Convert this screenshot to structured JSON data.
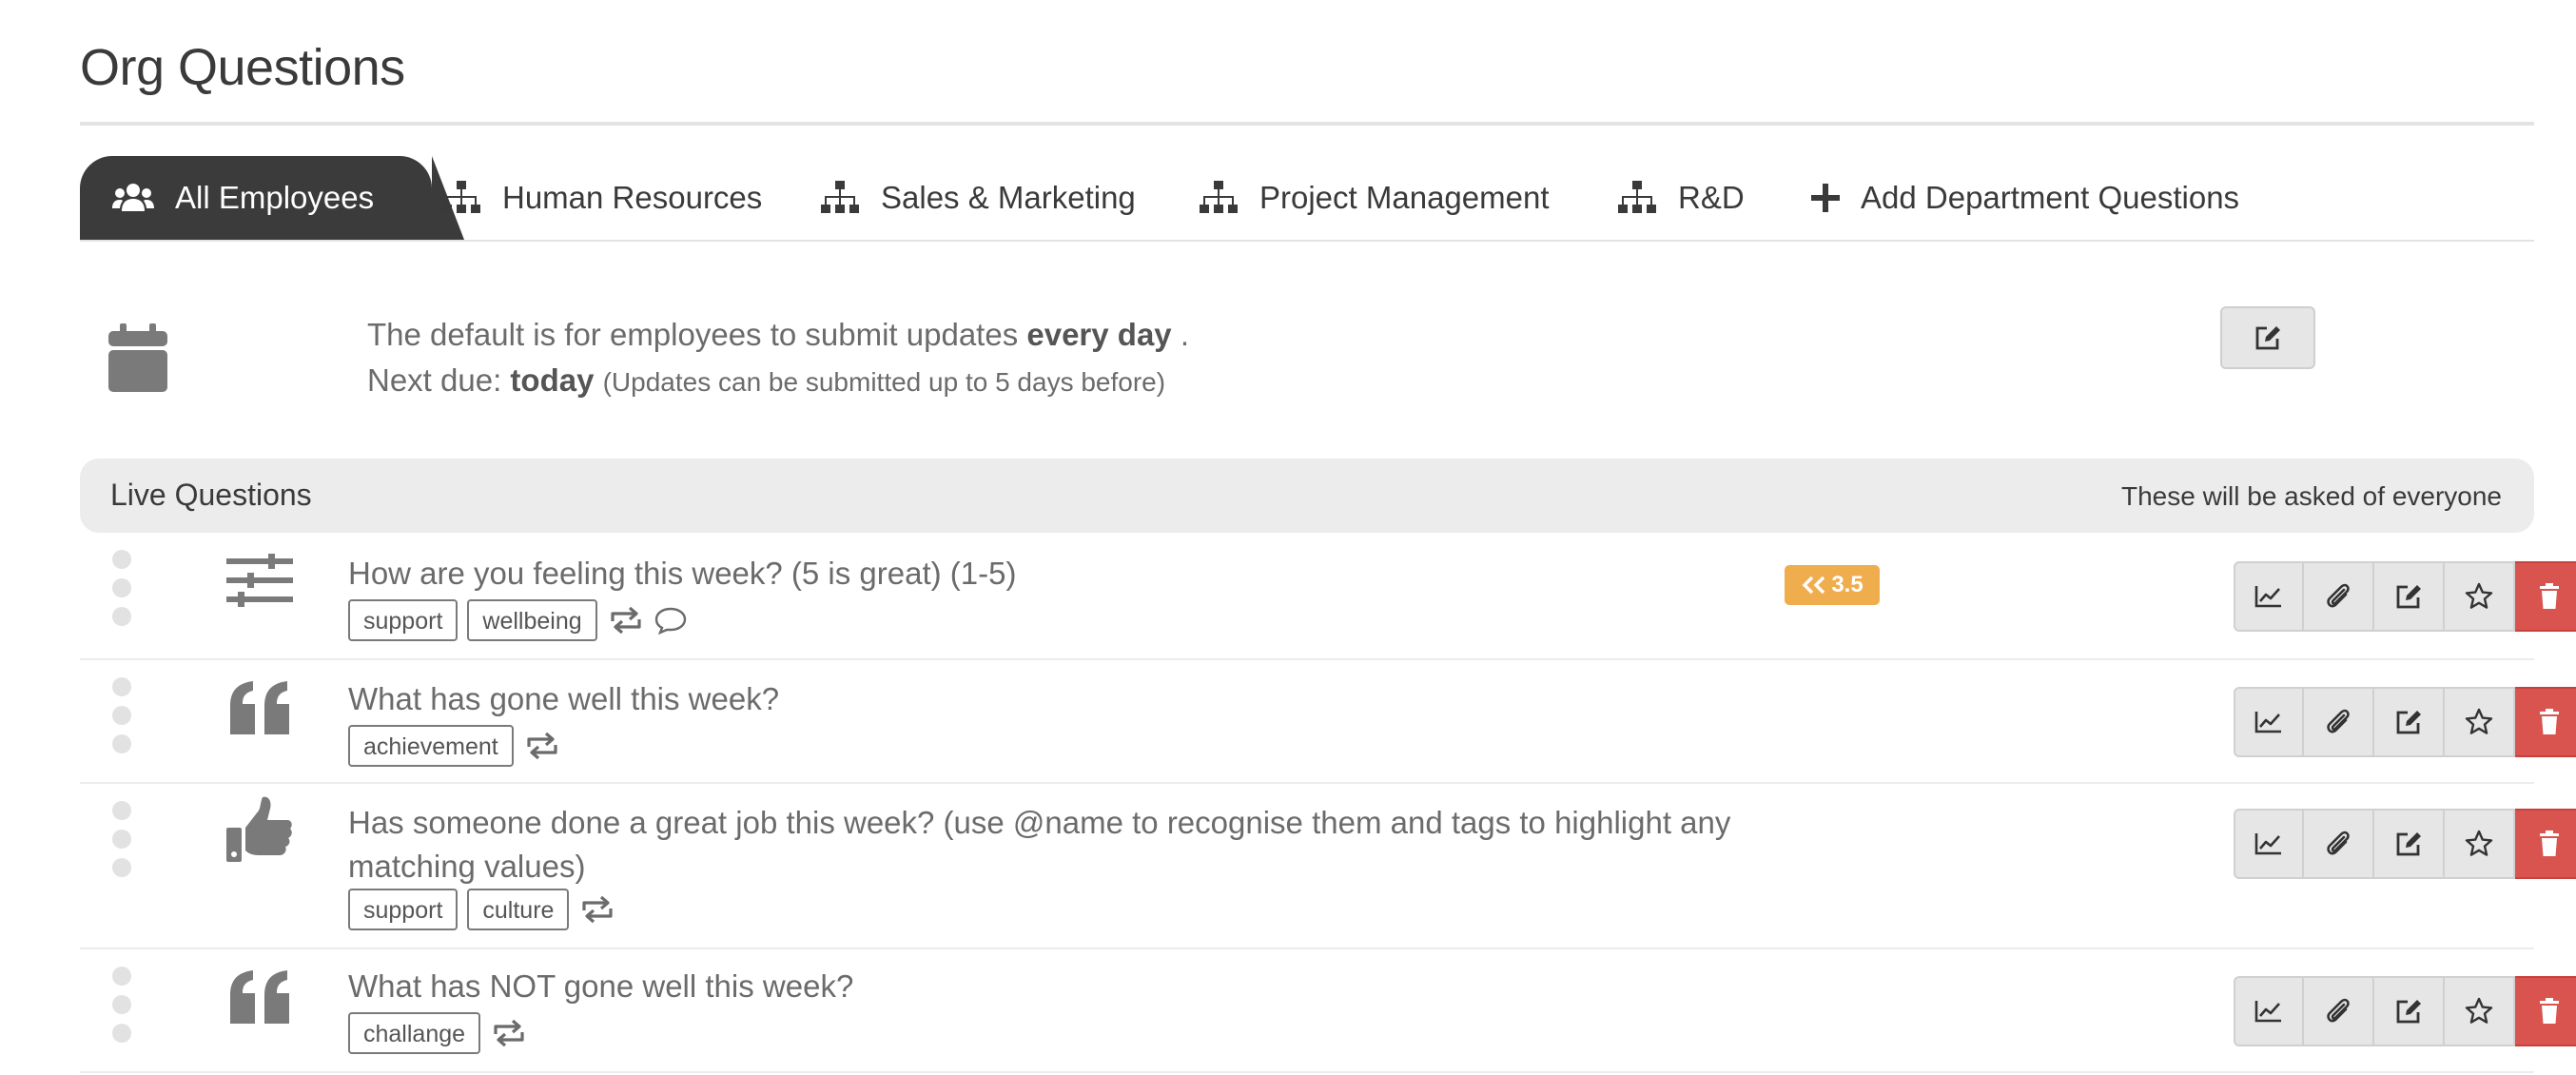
{
  "page": {
    "title": "Org Questions"
  },
  "tabs": [
    {
      "label": "All Employees",
      "icon": "users-icon",
      "active": true
    },
    {
      "label": "Human Resources",
      "icon": "org-chart-icon"
    },
    {
      "label": "Sales & Marketing",
      "icon": "org-chart-icon"
    },
    {
      "label": "Project Management",
      "icon": "org-chart-icon"
    },
    {
      "label": "R&D",
      "icon": "org-chart-icon"
    },
    {
      "label": "Add Department Questions",
      "icon": "plus-icon"
    }
  ],
  "schedule": {
    "line1_prefix": "The default is for employees to submit updates",
    "line1_bold": "every day",
    "line1_suffix": ".",
    "line2_prefix": "Next due:",
    "line2_bold": "today",
    "line2_note": "(Updates can be submitted up to 5 days before)",
    "icon": "calendar-icon"
  },
  "live_questions": {
    "title": "Live Questions",
    "note": "These will be asked of everyone"
  },
  "questions": [
    {
      "text": "How are you feeling this week? (5 is great) (1-5)",
      "type_icon": "sliders-icon",
      "tags": [
        "support",
        "wellbeing"
      ],
      "badge": "3.5"
    },
    {
      "text": "What has gone well this week?",
      "type_icon": "quote-icon",
      "tags": [
        "achievement"
      ]
    },
    {
      "text": "Has someone done a great job this week? (use @name to recognise them and tags to highlight any matching values)",
      "type_icon": "thumbs-up-icon",
      "tags": [
        "support",
        "culture"
      ]
    },
    {
      "text": "What has NOT gone well this week?",
      "type_icon": "quote-icon",
      "tags": [
        "challange"
      ]
    }
  ],
  "colors": {
    "active_tab": "#3b3b3b",
    "badge": "#f0ad4e",
    "delete": "#d9534f"
  }
}
